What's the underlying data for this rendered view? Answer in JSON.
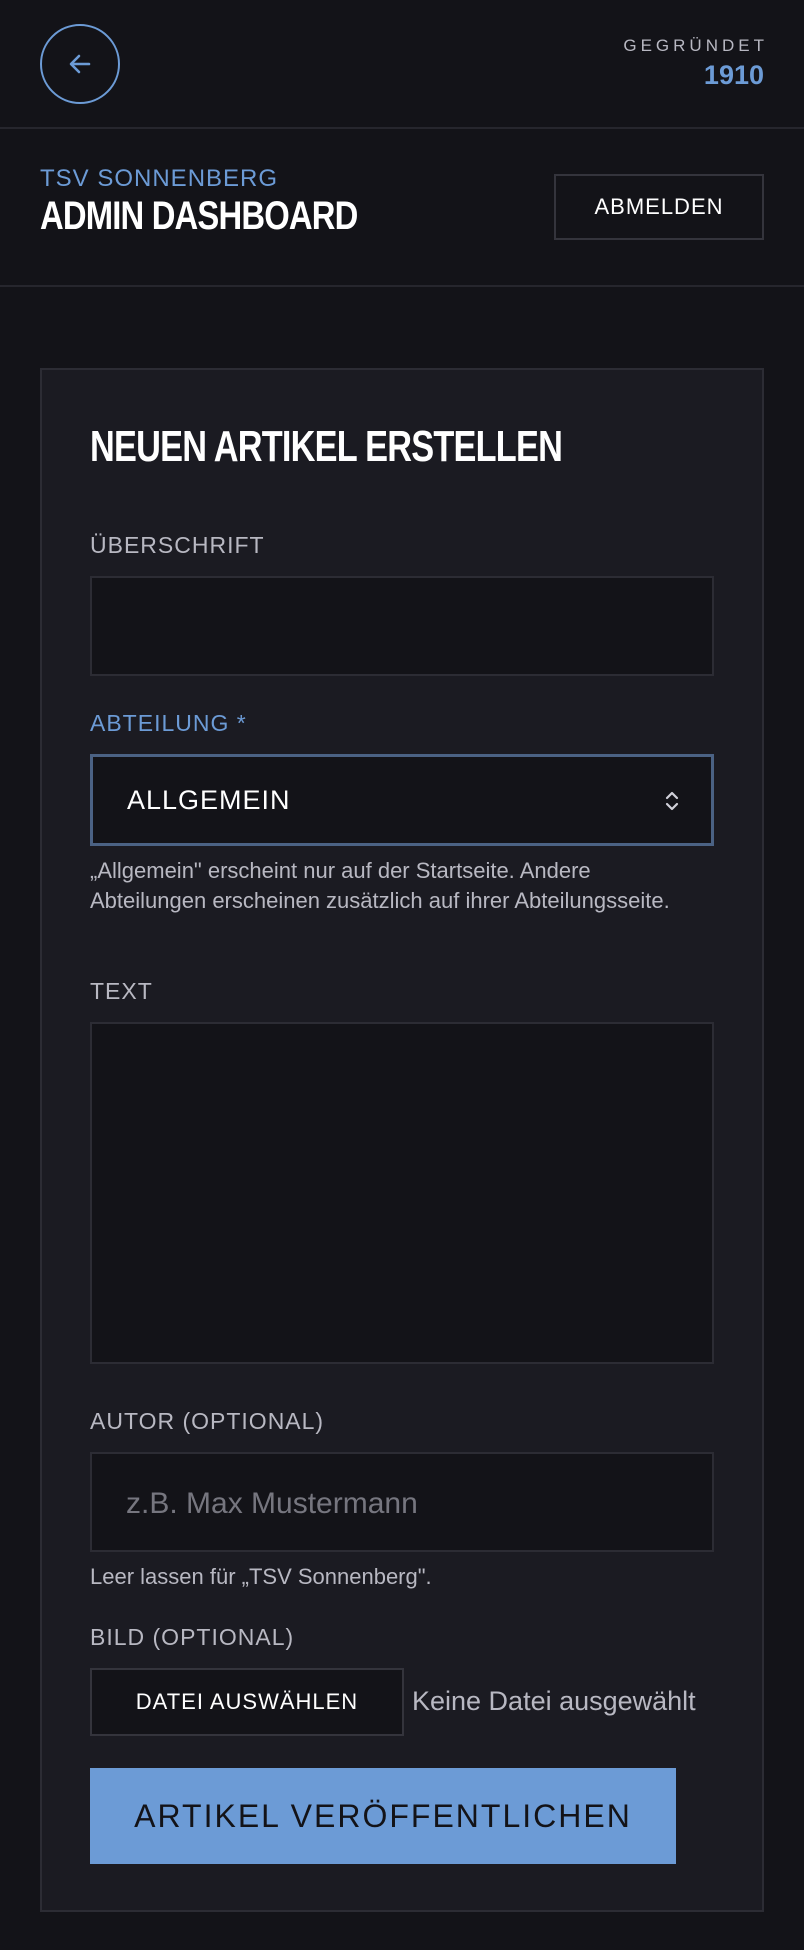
{
  "topbar": {
    "back_icon": "arrow-left-icon",
    "founded_label": "GEGRÜNDET",
    "founded_year": "1910"
  },
  "header": {
    "club_name": "TSV SONNENBERG",
    "title": "ADMIN DASHBOARD",
    "logout_label": "ABMELDEN"
  },
  "form": {
    "title": "NEUEN ARTIKEL ERSTELLEN",
    "headline": {
      "label": "ÜBERSCHRIFT",
      "value": ""
    },
    "department": {
      "label": "ABTEILUNG *",
      "selected": "ALLGEMEIN",
      "help": "„Allgemein\" erscheint nur auf der Startseite. Andere Abteilungen erscheinen zusätzlich auf ihrer Abteilungsseite."
    },
    "text": {
      "label": "TEXT",
      "value": ""
    },
    "author": {
      "label": "AUTOR (OPTIONAL)",
      "placeholder": "z.B. Max Mustermann",
      "help": "Leer lassen für „TSV Sonnenberg\"."
    },
    "image": {
      "label": "BILD (OPTIONAL)",
      "button_label": "DATEI AUSWÄHLEN",
      "status": "Keine Datei ausgewählt"
    },
    "submit_label": "ARTIKEL VERÖFFENTLICHEN"
  },
  "colors": {
    "background": "#131318",
    "card": "#1b1b22",
    "accent": "#6c9bd6",
    "text": "#ffffff",
    "muted": "#b8b8c2"
  }
}
